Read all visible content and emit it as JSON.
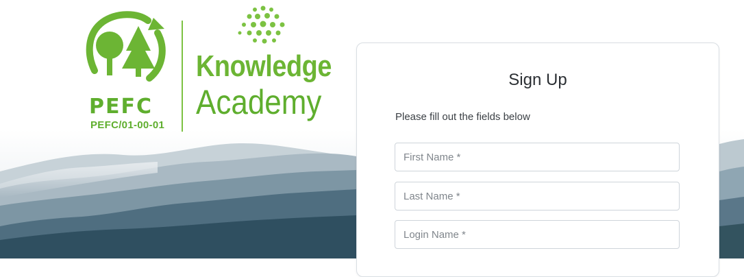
{
  "logo": {
    "pefc_word": "PEFC",
    "pefc_code": "PEFC/01-00-01",
    "brand_line1": "Knowledge",
    "brand_line2": "Academy",
    "green": "#6cb534"
  },
  "form": {
    "title": "Sign Up",
    "subtitle": "Please fill out the fields below",
    "fields": [
      {
        "placeholder": "First Name *",
        "value": ""
      },
      {
        "placeholder": "Last Name *",
        "value": ""
      },
      {
        "placeholder": "Login Name *",
        "value": ""
      }
    ]
  },
  "colors": {
    "card_border": "#d9dee3",
    "field_border": "#ced4da",
    "text": "#2b2f33"
  }
}
